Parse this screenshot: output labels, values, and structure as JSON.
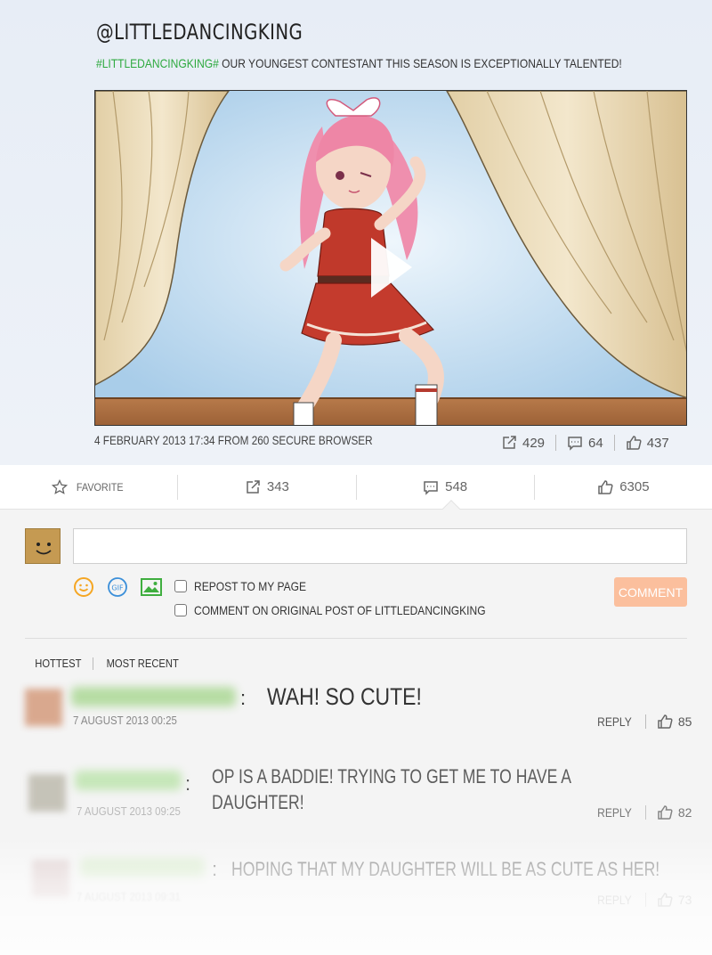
{
  "post": {
    "username": "@LITTLEDANCINGKING",
    "hashtag": "#LITTLEDANCINGKING#",
    "text": " OUR YOUNGEST CONTESTANT THIS SEASON IS EXCEPTIONALLY TALENTED!",
    "meta": "4 FEBRUARY 2013 17:34 FROM 260 SECURE BROWSER",
    "stats": {
      "reposts": "429",
      "comments": "64",
      "likes": "437"
    }
  },
  "actions": {
    "favorite_label": "FAVORITE",
    "repost_count": "343",
    "comment_count": "548",
    "like_count": "6305"
  },
  "composer": {
    "input_value": "",
    "repost_label": "REPOST TO MY PAGE",
    "comment_original_label": "COMMENT ON ORIGINAL POST OF LITTLEDANCINGKING",
    "comment_button": "COMMENT"
  },
  "sort": {
    "hottest": "HOTTEST",
    "recent": "MOST RECENT"
  },
  "comments": [
    {
      "text": "WAH! SO CUTE!",
      "line2": "",
      "time": "7 AUGUST 2013 00:25",
      "reply": "REPLY",
      "likes": "85"
    },
    {
      "text": "OP IS A BADDIE! TRYING TO GET ME TO HAVE A",
      "line2": "DAUGHTER!",
      "time": "7 AUGUST 2013 09:25",
      "reply": "REPLY",
      "likes": "82"
    },
    {
      "text": "HOPING THAT MY DAUGHTER WILL BE AS CUTE AS HER!",
      "line2": "",
      "time": "7 AUGUST 2013 09:31",
      "reply": "REPLY",
      "likes": "73"
    }
  ],
  "colors": {
    "hashtag": "#2eaa3f",
    "comment_button": "#fbbf9d",
    "emoji": "#f5a623",
    "gif": "#3b8fd9",
    "image": "#3fae3f"
  },
  "icons": [
    "star-icon",
    "repost-icon",
    "comment-icon",
    "thumbs-up-icon",
    "smiley-icon",
    "gif-icon",
    "image-icon",
    "play-icon"
  ]
}
